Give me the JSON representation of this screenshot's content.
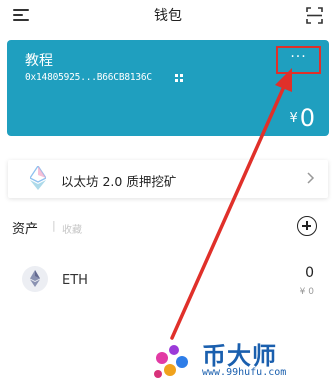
{
  "header": {
    "title": "钱包",
    "menu_icon": "hamburger-menu-icon",
    "scan_icon": "scan-icon"
  },
  "wallet_card": {
    "name": "教程",
    "address": "0x14805925...B66CB8136C",
    "more_label": "···",
    "balance_currency": "¥",
    "balance_value": "0",
    "color": "#1f9fbf"
  },
  "staking_banner": {
    "label": "以太坊 2.0 质押挖矿"
  },
  "assets": {
    "tab_assets": "资产",
    "separator": "|",
    "tab_favorites": "收藏",
    "items": [
      {
        "symbol": "ETH",
        "amount": "0",
        "value": "¥ 0"
      }
    ]
  },
  "annotation": {
    "arrow_color": "#e0302a"
  },
  "watermark": {
    "text": "币大师",
    "url": "www.99hufu.com"
  }
}
